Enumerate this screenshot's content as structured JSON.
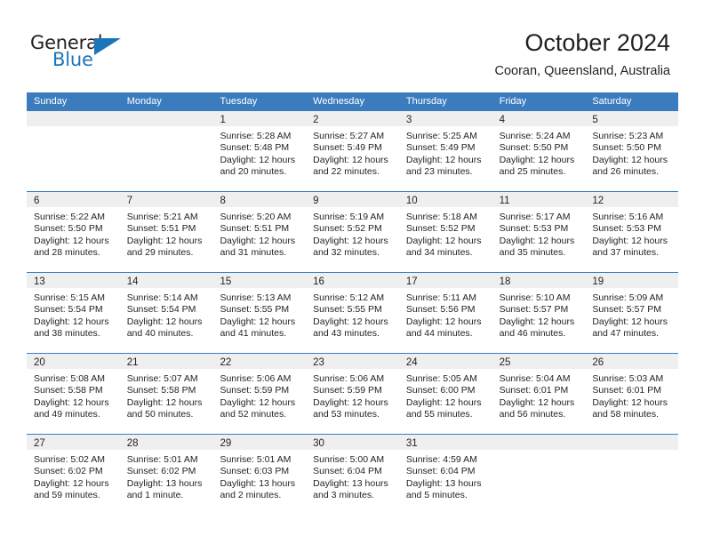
{
  "logo": {
    "word1": "General",
    "word2": "Blue",
    "triangle_color": "#1b75bb",
    "word1_color": "#231f20",
    "word2_color": "#1b75bb"
  },
  "header": {
    "title": "October 2024",
    "subtitle": "Cooran, Queensland, Australia"
  },
  "theme": {
    "header_blue": "#3a7cbe",
    "day_band_gray": "#efefef",
    "text_color": "#231f20"
  },
  "weekdays": [
    "Sunday",
    "Monday",
    "Tuesday",
    "Wednesday",
    "Thursday",
    "Friday",
    "Saturday"
  ],
  "weeks": [
    [
      {
        "day": "",
        "sunrise": "",
        "sunset": "",
        "daylight1": "",
        "daylight2": ""
      },
      {
        "day": "",
        "sunrise": "",
        "sunset": "",
        "daylight1": "",
        "daylight2": ""
      },
      {
        "day": "1",
        "sunrise": "Sunrise: 5:28 AM",
        "sunset": "Sunset: 5:48 PM",
        "daylight1": "Daylight: 12 hours",
        "daylight2": "and 20 minutes."
      },
      {
        "day": "2",
        "sunrise": "Sunrise: 5:27 AM",
        "sunset": "Sunset: 5:49 PM",
        "daylight1": "Daylight: 12 hours",
        "daylight2": "and 22 minutes."
      },
      {
        "day": "3",
        "sunrise": "Sunrise: 5:25 AM",
        "sunset": "Sunset: 5:49 PM",
        "daylight1": "Daylight: 12 hours",
        "daylight2": "and 23 minutes."
      },
      {
        "day": "4",
        "sunrise": "Sunrise: 5:24 AM",
        "sunset": "Sunset: 5:50 PM",
        "daylight1": "Daylight: 12 hours",
        "daylight2": "and 25 minutes."
      },
      {
        "day": "5",
        "sunrise": "Sunrise: 5:23 AM",
        "sunset": "Sunset: 5:50 PM",
        "daylight1": "Daylight: 12 hours",
        "daylight2": "and 26 minutes."
      }
    ],
    [
      {
        "day": "6",
        "sunrise": "Sunrise: 5:22 AM",
        "sunset": "Sunset: 5:50 PM",
        "daylight1": "Daylight: 12 hours",
        "daylight2": "and 28 minutes."
      },
      {
        "day": "7",
        "sunrise": "Sunrise: 5:21 AM",
        "sunset": "Sunset: 5:51 PM",
        "daylight1": "Daylight: 12 hours",
        "daylight2": "and 29 minutes."
      },
      {
        "day": "8",
        "sunrise": "Sunrise: 5:20 AM",
        "sunset": "Sunset: 5:51 PM",
        "daylight1": "Daylight: 12 hours",
        "daylight2": "and 31 minutes."
      },
      {
        "day": "9",
        "sunrise": "Sunrise: 5:19 AM",
        "sunset": "Sunset: 5:52 PM",
        "daylight1": "Daylight: 12 hours",
        "daylight2": "and 32 minutes."
      },
      {
        "day": "10",
        "sunrise": "Sunrise: 5:18 AM",
        "sunset": "Sunset: 5:52 PM",
        "daylight1": "Daylight: 12 hours",
        "daylight2": "and 34 minutes."
      },
      {
        "day": "11",
        "sunrise": "Sunrise: 5:17 AM",
        "sunset": "Sunset: 5:53 PM",
        "daylight1": "Daylight: 12 hours",
        "daylight2": "and 35 minutes."
      },
      {
        "day": "12",
        "sunrise": "Sunrise: 5:16 AM",
        "sunset": "Sunset: 5:53 PM",
        "daylight1": "Daylight: 12 hours",
        "daylight2": "and 37 minutes."
      }
    ],
    [
      {
        "day": "13",
        "sunrise": "Sunrise: 5:15 AM",
        "sunset": "Sunset: 5:54 PM",
        "daylight1": "Daylight: 12 hours",
        "daylight2": "and 38 minutes."
      },
      {
        "day": "14",
        "sunrise": "Sunrise: 5:14 AM",
        "sunset": "Sunset: 5:54 PM",
        "daylight1": "Daylight: 12 hours",
        "daylight2": "and 40 minutes."
      },
      {
        "day": "15",
        "sunrise": "Sunrise: 5:13 AM",
        "sunset": "Sunset: 5:55 PM",
        "daylight1": "Daylight: 12 hours",
        "daylight2": "and 41 minutes."
      },
      {
        "day": "16",
        "sunrise": "Sunrise: 5:12 AM",
        "sunset": "Sunset: 5:55 PM",
        "daylight1": "Daylight: 12 hours",
        "daylight2": "and 43 minutes."
      },
      {
        "day": "17",
        "sunrise": "Sunrise: 5:11 AM",
        "sunset": "Sunset: 5:56 PM",
        "daylight1": "Daylight: 12 hours",
        "daylight2": "and 44 minutes."
      },
      {
        "day": "18",
        "sunrise": "Sunrise: 5:10 AM",
        "sunset": "Sunset: 5:57 PM",
        "daylight1": "Daylight: 12 hours",
        "daylight2": "and 46 minutes."
      },
      {
        "day": "19",
        "sunrise": "Sunrise: 5:09 AM",
        "sunset": "Sunset: 5:57 PM",
        "daylight1": "Daylight: 12 hours",
        "daylight2": "and 47 minutes."
      }
    ],
    [
      {
        "day": "20",
        "sunrise": "Sunrise: 5:08 AM",
        "sunset": "Sunset: 5:58 PM",
        "daylight1": "Daylight: 12 hours",
        "daylight2": "and 49 minutes."
      },
      {
        "day": "21",
        "sunrise": "Sunrise: 5:07 AM",
        "sunset": "Sunset: 5:58 PM",
        "daylight1": "Daylight: 12 hours",
        "daylight2": "and 50 minutes."
      },
      {
        "day": "22",
        "sunrise": "Sunrise: 5:06 AM",
        "sunset": "Sunset: 5:59 PM",
        "daylight1": "Daylight: 12 hours",
        "daylight2": "and 52 minutes."
      },
      {
        "day": "23",
        "sunrise": "Sunrise: 5:06 AM",
        "sunset": "Sunset: 5:59 PM",
        "daylight1": "Daylight: 12 hours",
        "daylight2": "and 53 minutes."
      },
      {
        "day": "24",
        "sunrise": "Sunrise: 5:05 AM",
        "sunset": "Sunset: 6:00 PM",
        "daylight1": "Daylight: 12 hours",
        "daylight2": "and 55 minutes."
      },
      {
        "day": "25",
        "sunrise": "Sunrise: 5:04 AM",
        "sunset": "Sunset: 6:01 PM",
        "daylight1": "Daylight: 12 hours",
        "daylight2": "and 56 minutes."
      },
      {
        "day": "26",
        "sunrise": "Sunrise: 5:03 AM",
        "sunset": "Sunset: 6:01 PM",
        "daylight1": "Daylight: 12 hours",
        "daylight2": "and 58 minutes."
      }
    ],
    [
      {
        "day": "27",
        "sunrise": "Sunrise: 5:02 AM",
        "sunset": "Sunset: 6:02 PM",
        "daylight1": "Daylight: 12 hours",
        "daylight2": "and 59 minutes."
      },
      {
        "day": "28",
        "sunrise": "Sunrise: 5:01 AM",
        "sunset": "Sunset: 6:02 PM",
        "daylight1": "Daylight: 13 hours",
        "daylight2": "and 1 minute."
      },
      {
        "day": "29",
        "sunrise": "Sunrise: 5:01 AM",
        "sunset": "Sunset: 6:03 PM",
        "daylight1": "Daylight: 13 hours",
        "daylight2": "and 2 minutes."
      },
      {
        "day": "30",
        "sunrise": "Sunrise: 5:00 AM",
        "sunset": "Sunset: 6:04 PM",
        "daylight1": "Daylight: 13 hours",
        "daylight2": "and 3 minutes."
      },
      {
        "day": "31",
        "sunrise": "Sunrise: 4:59 AM",
        "sunset": "Sunset: 6:04 PM",
        "daylight1": "Daylight: 13 hours",
        "daylight2": "and 5 minutes."
      },
      {
        "day": "",
        "sunrise": "",
        "sunset": "",
        "daylight1": "",
        "daylight2": ""
      },
      {
        "day": "",
        "sunrise": "",
        "sunset": "",
        "daylight1": "",
        "daylight2": ""
      }
    ]
  ]
}
